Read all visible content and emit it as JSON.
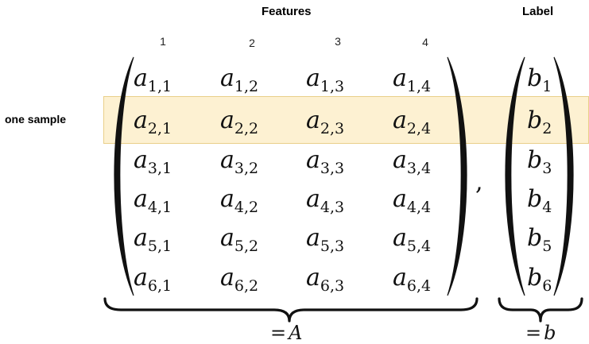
{
  "headers": {
    "features": "Features",
    "label": "Label"
  },
  "column_numbers": [
    "1",
    "2",
    "3",
    "4"
  ],
  "row_label": "one sample",
  "matrix_A": {
    "symbol": "a",
    "rows": [
      [
        "1,1",
        "1,2",
        "1,3",
        "1,4"
      ],
      [
        "2,1",
        "2,2",
        "2,3",
        "2,4"
      ],
      [
        "3,1",
        "3,2",
        "3,3",
        "3,4"
      ],
      [
        "4,1",
        "4,2",
        "4,3",
        "4,4"
      ],
      [
        "5,1",
        "5,2",
        "5,3",
        "5,4"
      ],
      [
        "6,1",
        "6,2",
        "6,3",
        "6,4"
      ]
    ],
    "underbrace_label": {
      "eq": "=",
      "name": "A"
    }
  },
  "vector_b": {
    "symbol": "b",
    "entries": [
      "1",
      "2",
      "3",
      "4",
      "5",
      "6"
    ],
    "underbrace_label": {
      "eq": "=",
      "name": "b"
    }
  },
  "separator": ",",
  "highlight_color": "#fdf1d2"
}
